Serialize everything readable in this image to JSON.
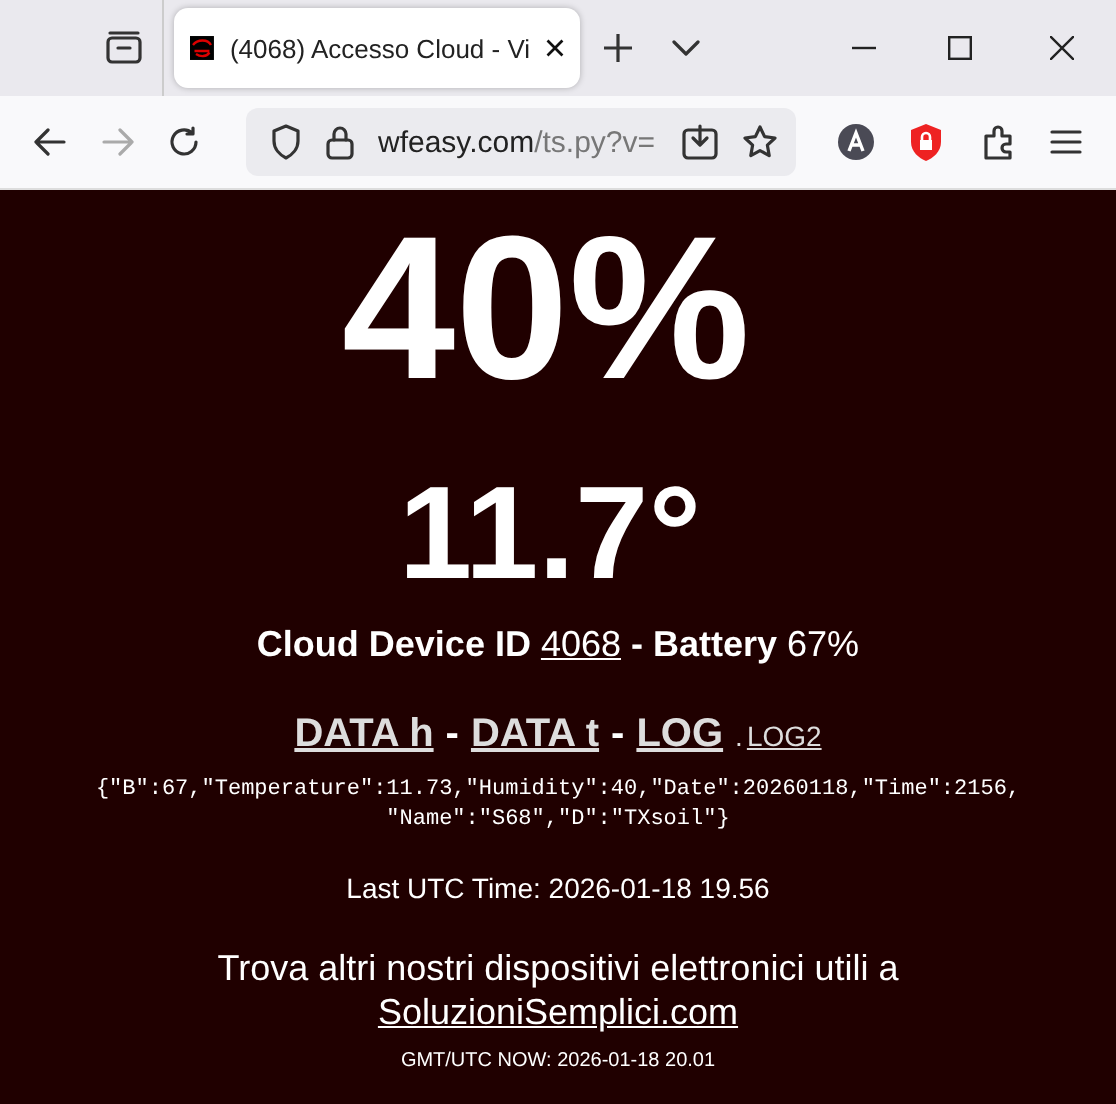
{
  "browser": {
    "tab": {
      "title": "(4068) Accesso Cloud - Vi",
      "selected": true
    },
    "url": {
      "host": "wfeasy.com",
      "path": "/ts.py?v="
    }
  },
  "page": {
    "humidity": "40%",
    "temperature": "11.7°",
    "device": {
      "label": "Cloud Device ID",
      "id": "4068",
      "battery_label": "- Battery",
      "battery": "67%"
    },
    "links": [
      {
        "kind": "big",
        "text": "DATA h"
      },
      {
        "kind": "sep",
        "text": "-"
      },
      {
        "kind": "big",
        "text": "DATA t"
      },
      {
        "kind": "sep",
        "text": "-"
      },
      {
        "kind": "big",
        "text": "LOG"
      },
      {
        "kind": "dot",
        "text": "."
      },
      {
        "kind": "small",
        "text": "LOG2"
      }
    ],
    "raw_json_lines": [
      "{\"B\":67,\"Temperature\":11.73,\"Humidity\":40,\"Date\":20260118,\"Time\":2156,",
      "\"Name\":\"S68\",\"D\":\"TXsoil\"}"
    ],
    "last_time": "Last UTC Time: 2026-01-18 19.56",
    "promo": "Trova altri nostri dispositivi elettronici utili a",
    "promo_link": "SoluzioniSemplici.com",
    "now": "GMT/UTC NOW: 2026-01-18 20.01"
  }
}
